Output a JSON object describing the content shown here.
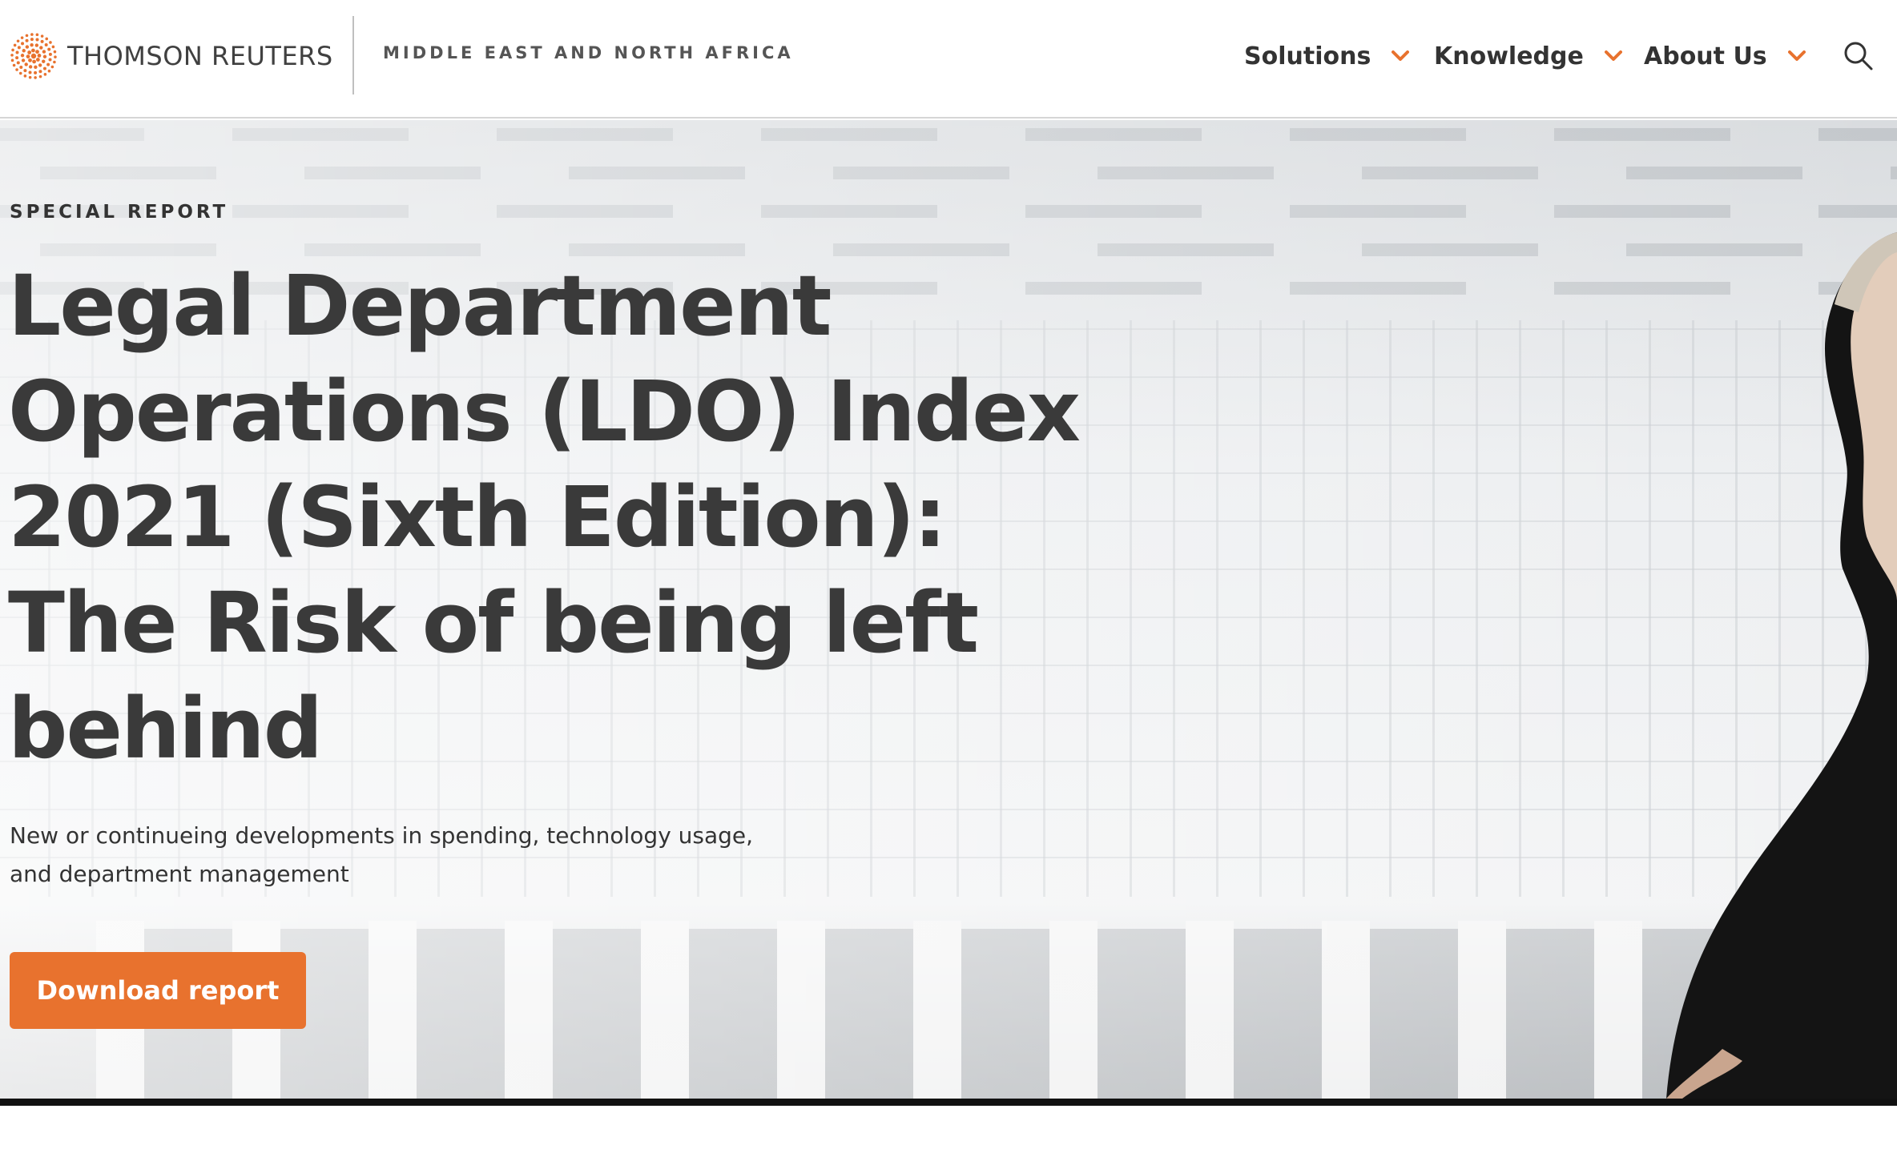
{
  "header": {
    "logo_text": "THOMSON REUTERS",
    "logo_icon": "thomson-reuters-dot-globe",
    "region": "MIDDLE EAST AND NORTH AFRICA",
    "nav": [
      {
        "label": "Solutions",
        "icon": "chevron-down-icon"
      },
      {
        "label": "Knowledge",
        "icon": "chevron-down-icon"
      },
      {
        "label": "About Us",
        "icon": "chevron-down-icon"
      }
    ],
    "search_icon": "search-icon"
  },
  "hero": {
    "eyebrow": "SPECIAL REPORT",
    "headline": "Legal Department Operations (LDO) Index 2021 (Sixth Edition): The Risk of being left behind",
    "subtitle": "New or continueing developments in spending, technology usage, and department management",
    "cta_label": "Download report"
  },
  "colors": {
    "accent": "#e8722e",
    "text_dark": "#3a3a3a",
    "header_bg": "#ffffff"
  }
}
